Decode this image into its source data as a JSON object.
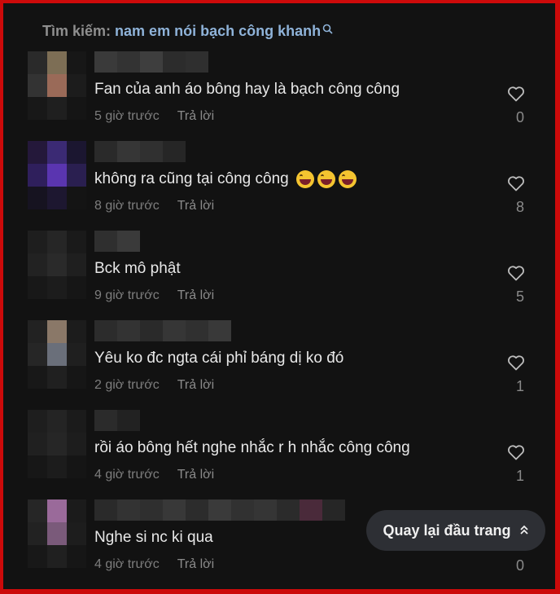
{
  "search": {
    "prefix": "Tìm kiếm:",
    "query": "nam em nói bạch công khanh",
    "icon": "search-icon"
  },
  "comments": [
    {
      "text": "Fan của anh áo bông hay là bạch công công",
      "time": "5 giờ trước",
      "reply": "Trả lời",
      "likes": "0"
    },
    {
      "text": "không ra cũng tại công công",
      "emoji_count": 3,
      "time": "8 giờ trước",
      "reply": "Trả lời",
      "likes": "8"
    },
    {
      "text": "Bck mô phật",
      "time": "9 giờ trước",
      "reply": "Trả lời",
      "likes": "5"
    },
    {
      "text": "Yêu ko đc ngta cái phỉ báng dị ko đó",
      "time": "2 giờ trước",
      "reply": "Trả lời",
      "likes": "1"
    },
    {
      "text": "rồi áo bông hết nghe nhắc r h nhắc công công",
      "time": "4 giờ trước",
      "reply": "Trả lời",
      "likes": "1"
    },
    {
      "text": "Nghe si nc ki qua",
      "time": "4 giờ trước",
      "reply": "Trả lời",
      "likes": "0"
    }
  ],
  "back_to_top": {
    "label": "Quay lại đầu trang",
    "icon": "double-chevron-up-icon"
  },
  "colors": {
    "frame_border": "#cc0a0a",
    "background": "#121212",
    "query_link": "#8fb3d9"
  }
}
